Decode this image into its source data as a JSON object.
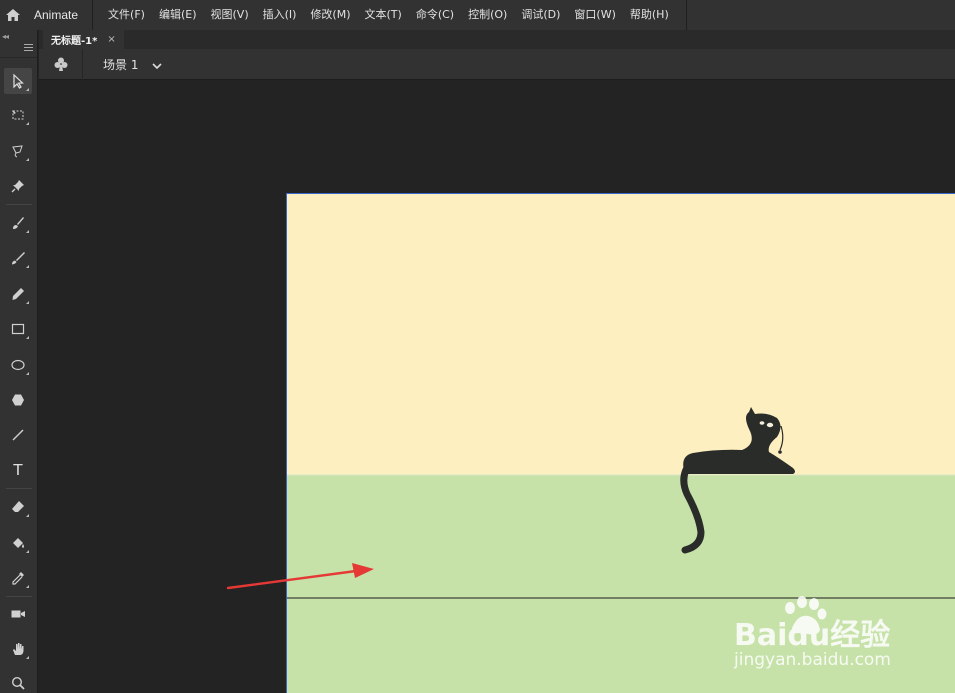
{
  "app": {
    "name": "Animate"
  },
  "menu": {
    "items": [
      "文件(F)",
      "编辑(E)",
      "视图(V)",
      "插入(I)",
      "修改(M)",
      "文本(T)",
      "命令(C)",
      "控制(O)",
      "调试(D)",
      "窗口(W)",
      "帮助(H)"
    ]
  },
  "document": {
    "tab_title": "无标题-1*",
    "close_glyph": "×"
  },
  "scene": {
    "label": "场景 1"
  },
  "tools": [
    "selection-tool-icon",
    "free-transform-tool-icon",
    "lasso-tool-icon",
    "pin-tool-icon",
    "paint-brush-tool-icon",
    "brush-tool-icon",
    "pencil-tool-icon",
    "rectangle-tool-icon",
    "oval-tool-icon",
    "polystar-tool-icon",
    "line-tool-icon",
    "text-tool-icon",
    "eraser-tool-icon",
    "paint-bucket-tool-icon",
    "eyedropper-tool-icon",
    "camera-tool-icon",
    "hand-tool-icon",
    "zoom-tool-icon"
  ],
  "text_tool_glyph": "T",
  "watermark": {
    "logo": "Baidu经验",
    "url": "jingyan.baidu.com"
  },
  "colors": {
    "sky": "#fdefc0",
    "ground": "#c6e2a9",
    "cat": "#2a2c2a",
    "arrow": "#e53935",
    "stage_border": "#3a67c7"
  }
}
